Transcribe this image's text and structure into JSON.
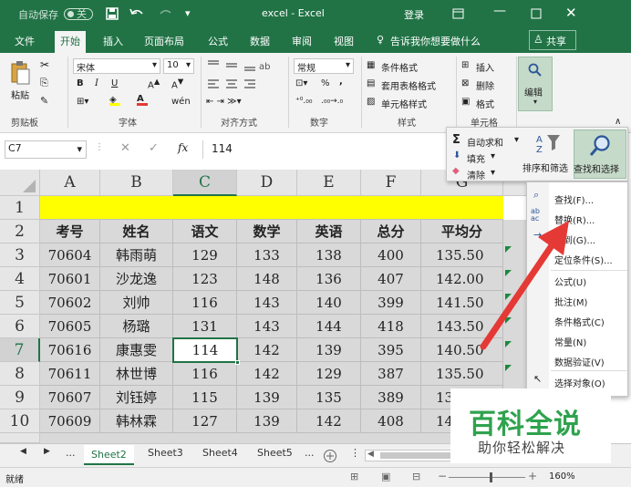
{
  "titlebar": {
    "autosave_label": "自动保存",
    "autosave_state": "关",
    "title": "excel - Excel",
    "login": "登录"
  },
  "tabs": [
    {
      "label": "文件"
    },
    {
      "label": "开始"
    },
    {
      "label": "插入"
    },
    {
      "label": "页面布局"
    },
    {
      "label": "公式"
    },
    {
      "label": "数据"
    },
    {
      "label": "审阅"
    },
    {
      "label": "视图"
    }
  ],
  "tellme": "告诉我你想要做什么",
  "share": "共享",
  "ribbon": {
    "paste": "粘贴",
    "font_name": "宋体",
    "font_size": "10",
    "number_format": "常规",
    "cond_format": "条件格式",
    "table_format": "套用表格格式",
    "cell_style": "单元格样式",
    "insert": "插入",
    "delete": "删除",
    "format": "格式",
    "editing": "编辑",
    "groups": {
      "clipboard": "剪贴板",
      "font": "字体",
      "align": "对齐方式",
      "number": "数字",
      "styles": "样式",
      "cells": "单元格"
    },
    "bold": "B",
    "italic": "I",
    "underline": "U",
    "percent": "%",
    "comma": ","
  },
  "formula_bar": {
    "name_box": "C7",
    "fx": "fx",
    "value": "114"
  },
  "edit_panel": {
    "autosum": "自动求和",
    "fill": "填充",
    "clear": "清除",
    "sort_filter": "排序和筛选",
    "find_select": "查找和选择"
  },
  "find_menu": [
    {
      "label": "查找(F)..."
    },
    {
      "label": "替换(R)..."
    },
    {
      "label": "转到(G)..."
    },
    {
      "label": "定位条件(S)..."
    },
    {
      "label": "公式(U)"
    },
    {
      "label": "批注(M)"
    },
    {
      "label": "条件格式(C)"
    },
    {
      "label": "常量(N)"
    },
    {
      "label": "数据验证(V)"
    },
    {
      "label": "选择对象(O)"
    }
  ],
  "sheet": {
    "columns": [
      "A",
      "B",
      "C",
      "D",
      "E",
      "F",
      "G"
    ],
    "rows": [
      "1",
      "2",
      "3",
      "4",
      "5",
      "6",
      "7",
      "8",
      "9",
      "10"
    ],
    "header": [
      "考号",
      "姓名",
      "语文",
      "数学",
      "英语",
      "总分",
      "平均分"
    ],
    "data": [
      [
        "70604",
        "韩雨萌",
        "129",
        "133",
        "138",
        "400",
        "135.50"
      ],
      [
        "70601",
        "沙龙逸",
        "123",
        "148",
        "136",
        "407",
        "142.00"
      ],
      [
        "70602",
        "刘帅",
        "116",
        "143",
        "140",
        "399",
        "141.50"
      ],
      [
        "70605",
        "杨璐",
        "131",
        "143",
        "144",
        "418",
        "143.50"
      ],
      [
        "70616",
        "康惠雯",
        "114",
        "142",
        "139",
        "395",
        "140.50"
      ],
      [
        "70611",
        "林世博",
        "116",
        "142",
        "129",
        "387",
        "135.50"
      ],
      [
        "70607",
        "刘钰婷",
        "115",
        "139",
        "135",
        "389",
        "13"
      ],
      [
        "70609",
        "韩林霖",
        "127",
        "139",
        "142",
        "408",
        "14"
      ]
    ]
  },
  "sheet_tabs": [
    {
      "label": "..."
    },
    {
      "label": "Sheet2"
    },
    {
      "label": "Sheet3"
    },
    {
      "label": "Sheet4"
    },
    {
      "label": "Sheet5"
    },
    {
      "label": "..."
    }
  ],
  "status": {
    "ready": "就绪",
    "zoom": "160%"
  },
  "watermark": {
    "title": "百科全说",
    "subtitle": "助你轻松解决"
  },
  "colors": {
    "excel_green": "#217346",
    "header_fill": "#d9d9d9",
    "yellow_row": "#ffff00",
    "arrow": "#e53935"
  }
}
